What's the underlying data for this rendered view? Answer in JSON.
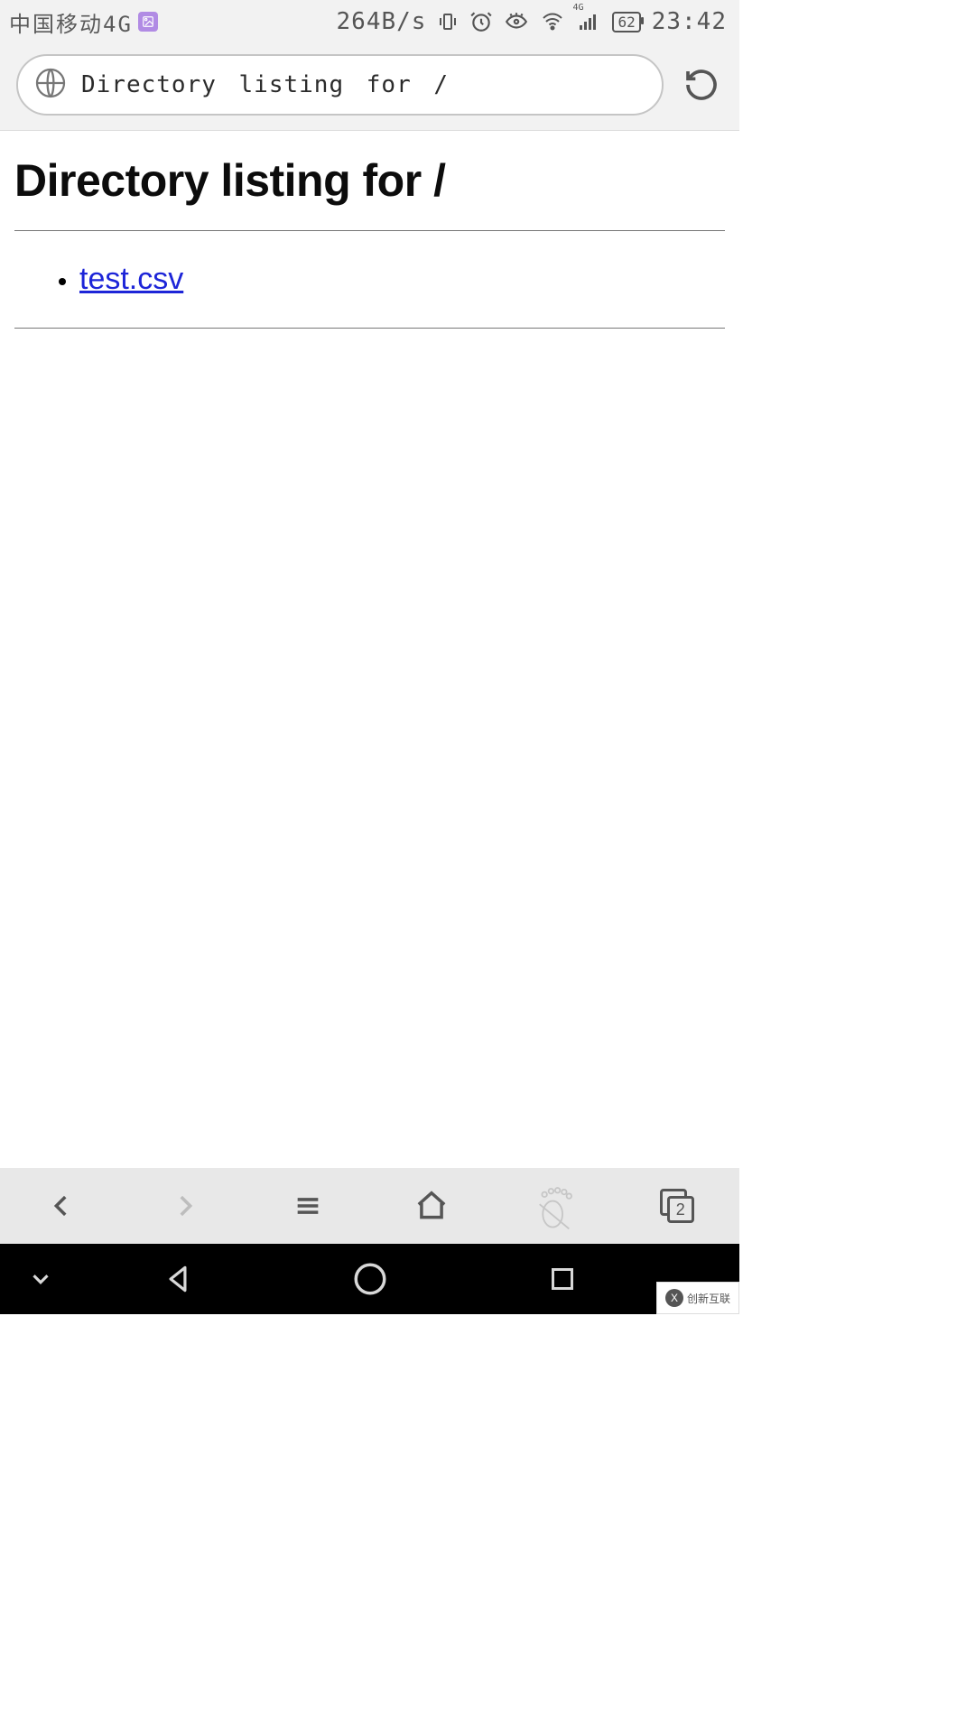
{
  "statusbar": {
    "carrier": "中国移动4G",
    "net_rate": "264B/s",
    "network_badge": "4G",
    "battery_pct": "62",
    "time": "23:42"
  },
  "chrome": {
    "url_display": "Directory listing for /"
  },
  "page": {
    "heading": "Directory listing for /",
    "files": [
      {
        "name": "test.csv"
      }
    ]
  },
  "browser_nav": {
    "tabs_count": "2"
  },
  "watermark": {
    "label": "创新互联"
  }
}
